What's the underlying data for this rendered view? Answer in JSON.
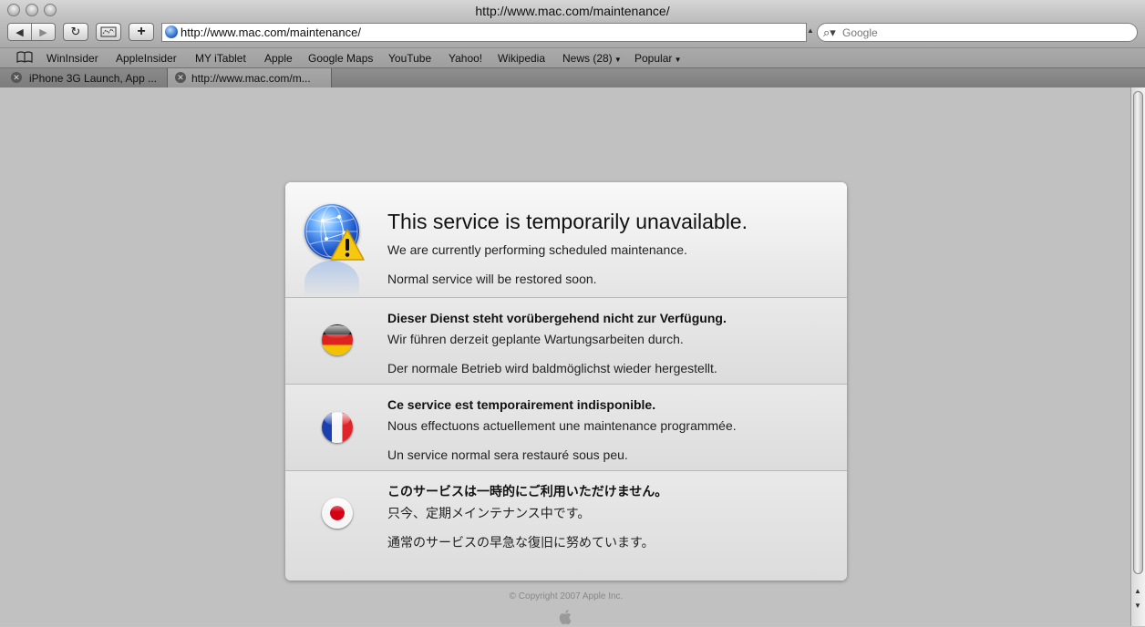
{
  "window": {
    "title": "http://www.mac.com/maintenance/"
  },
  "toolbar": {
    "back_icon": "back-arrow-icon",
    "forward_icon": "forward-arrow-icon",
    "reload_label": "↻",
    "add_label": "+",
    "url": "http://www.mac.com/maintenance/",
    "search_placeholder": "Google"
  },
  "bookmarks": {
    "items": [
      "WinInsider",
      "AppleInsider",
      "MY iTablet",
      "Apple",
      "Google Maps",
      "YouTube",
      "Yahoo!",
      "Wikipedia",
      "News (28)",
      "Popular"
    ]
  },
  "tabs": [
    {
      "label": "iPhone 3G Launch, App ...",
      "active": false
    },
    {
      "label": "http://www.mac.com/m...",
      "active": true
    }
  ],
  "notice": {
    "en": {
      "heading": "This service is temporarily unavailable.",
      "line1": "We are currently performing scheduled maintenance.",
      "line2": "Normal service will be restored soon."
    },
    "de": {
      "heading": "Dieser Dienst steht vorübergehend nicht zur Verfügung.",
      "line1": "Wir führen derzeit geplante Wartungsarbeiten durch.",
      "line2": "Der normale Betrieb wird baldmöglichst wieder hergestellt."
    },
    "fr": {
      "heading": "Ce service est temporairement indisponible.",
      "line1": "Nous effectuons actuellement une maintenance programmée.",
      "line2": "Un service normal sera restauré sous peu."
    },
    "jp": {
      "heading": "このサービスは一時的にご利用いただけません。",
      "line1": "只今、定期メインテナンス中です。",
      "line2": "通常のサービスの早急な復旧に努めています。"
    }
  },
  "footer": {
    "copyright": "© Copyright 2007 Apple Inc."
  }
}
